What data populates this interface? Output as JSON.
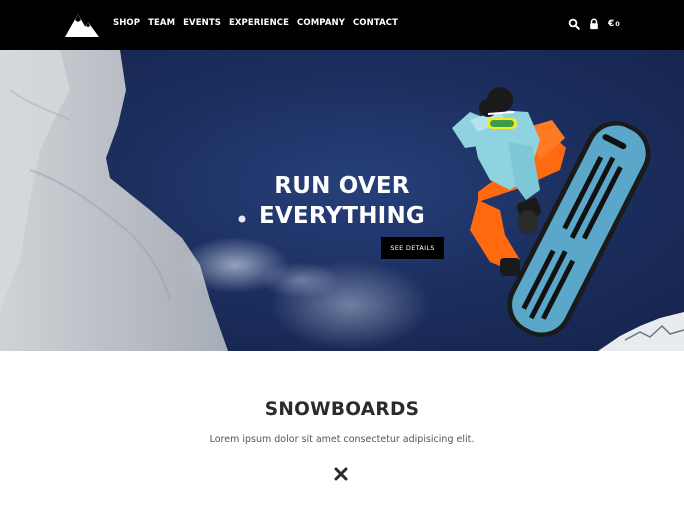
{
  "nav": {
    "items": [
      {
        "label": "SHOP"
      },
      {
        "label": "TEAM"
      },
      {
        "label": "EVENTS"
      },
      {
        "label": "EXPERIENCE"
      },
      {
        "label": "COMPANY"
      },
      {
        "label": "CONTACT"
      }
    ],
    "tools": {
      "search_icon": "search-icon",
      "account_icon": "lock-icon",
      "cart_currency": "€",
      "cart_count": "0"
    }
  },
  "hero": {
    "title_line1": "RUN OVER",
    "title_line2": "EVERYTHING",
    "cta_label": "SEE DETAILS"
  },
  "section": {
    "title": "SNOWBOARDS",
    "description": "Lorem ipsum dolor sit amet consectetur adipisicing elit.",
    "icon": "close-icon"
  },
  "colors": {
    "header_bg": "#000000",
    "sky": "#1c2f60",
    "board": "#5aa7c9",
    "jacket": "#8fd3e0",
    "pants": "#ff6a10"
  }
}
